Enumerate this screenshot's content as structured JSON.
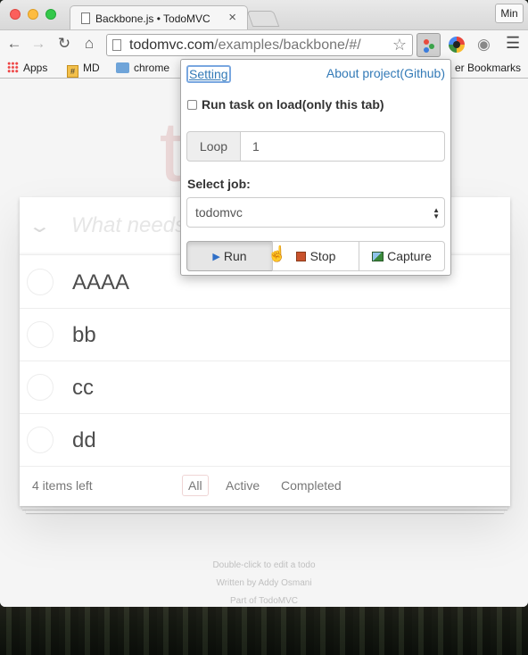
{
  "browser": {
    "tab_title": "Backbone.js • TodoMVC",
    "tab_close": "×",
    "min_label": "Min",
    "url_host": "todomvc.com",
    "url_path": "/examples/backbone/#/",
    "bookmarks": [
      "Apps",
      "MD",
      "chrome",
      "er Bookmarks"
    ]
  },
  "todo": {
    "title": "todos",
    "new_placeholder": "What needs to be done?",
    "items": [
      "AAAA",
      "bb",
      "cc",
      "dd"
    ],
    "count_text": "4 items left",
    "filters": [
      "All",
      "Active",
      "Completed"
    ],
    "selected_filter": "All",
    "info_1": "Double-click to edit a todo",
    "info_2_prefix": "Written by ",
    "info_2_author": "Addy Osmani",
    "info_3_prefix": "Part of ",
    "info_3_link": "TodoMVC"
  },
  "popup": {
    "setting_link": "Setting",
    "about_link": "About project(Github)",
    "autorun_label": "Run task on load(only this tab)",
    "autorun_checked": false,
    "loop_label": "Loop",
    "loop_value": "1",
    "select_label": "Select job:",
    "job_selected": "todomvc",
    "run_label": "Run",
    "stop_label": "Stop",
    "capture_label": "Capture"
  }
}
